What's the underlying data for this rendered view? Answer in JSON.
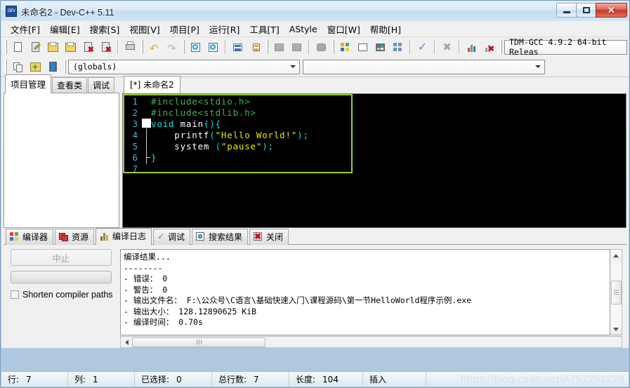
{
  "window": {
    "title": "未命名2 - Dev-C++ 5.11",
    "app_icon": "devcpp-icon",
    "minimize_label": "最小化",
    "maximize_label": "还原",
    "close_label": "关闭"
  },
  "menubar": [
    {
      "text": "文件[F]",
      "name": "menu-file"
    },
    {
      "text": "编辑[E]",
      "name": "menu-edit"
    },
    {
      "text": "搜索[S]",
      "name": "menu-search"
    },
    {
      "text": "视图[V]",
      "name": "menu-view"
    },
    {
      "text": "项目[P]",
      "name": "menu-project"
    },
    {
      "text": "运行[R]",
      "name": "menu-run"
    },
    {
      "text": "工具[T]",
      "name": "menu-tools"
    },
    {
      "text": "AStyle",
      "name": "menu-astyle"
    },
    {
      "text": "窗口[W]",
      "name": "menu-window"
    },
    {
      "text": "帮助[H]",
      "name": "menu-help"
    }
  ],
  "toolbar": {
    "icons": [
      "new-file-icon",
      "open-file-icon",
      "save-icon",
      "save-all-icon",
      "close-file-icon",
      "close-all-icon",
      "print-icon",
      "undo-icon",
      "redo-icon",
      "find-icon",
      "replace-icon",
      "goto-line-icon",
      "goto-function-icon",
      "back-icon",
      "forward-icon",
      "toggle-panel-icon",
      "compile-icon",
      "run-icon",
      "compile-run-icon",
      "rebuild-all-icon",
      "syntax-check-icon",
      "stop-execution-icon",
      "profile-icon",
      "debug-icon"
    ],
    "compiler_set": "TDM-GCC 4.9.2 64-bit Releas"
  },
  "toolbar2": {
    "icons": [
      "insert-icon",
      "toggle-bookmark-icon",
      "goto-bookmark-icon"
    ],
    "scope_combo": "(globals)",
    "member_combo": ""
  },
  "left_panel": {
    "tabs": [
      {
        "label": "项目管理",
        "name": "tab-project-manager",
        "active": true
      },
      {
        "label": "查看类",
        "name": "tab-class-browser",
        "active": false
      },
      {
        "label": "调试",
        "name": "tab-debug",
        "active": false
      }
    ]
  },
  "editor": {
    "tab_label": "[*] 未命名2",
    "lines": [
      {
        "num": "1",
        "tokens": [
          {
            "t": "#include<stdio.h>",
            "c": "c-pre"
          }
        ]
      },
      {
        "num": "2",
        "tokens": [
          {
            "t": "#include<stdlib.h>",
            "c": "c-pre"
          }
        ]
      },
      {
        "num": "3",
        "tokens": [
          {
            "t": "void ",
            "c": "c-kw"
          },
          {
            "t": "main",
            "c": "c-id"
          },
          {
            "t": "(){",
            "c": "c-pun"
          }
        ]
      },
      {
        "num": "4",
        "tokens": [
          {
            "t": "    printf",
            "c": "c-id"
          },
          {
            "t": "(",
            "c": "c-pun"
          },
          {
            "t": "\"Hello World!\"",
            "c": "c-str"
          },
          {
            "t": ");",
            "c": "c-pun"
          }
        ]
      },
      {
        "num": "5",
        "tokens": [
          {
            "t": "    system ",
            "c": "c-id"
          },
          {
            "t": "(",
            "c": "c-pun"
          },
          {
            "t": "\"pause\"",
            "c": "c-str"
          },
          {
            "t": ");",
            "c": "c-pun"
          }
        ]
      },
      {
        "num": "6",
        "tokens": [
          {
            "t": "}",
            "c": "c-pun"
          }
        ]
      },
      {
        "num": "7",
        "tokens": [
          {
            "t": "",
            "c": "c-id"
          }
        ]
      }
    ],
    "colors": {
      "background": "#000000",
      "preprocessor": "#3cb44a",
      "keyword": "#00e5e5",
      "identifier": "#ffffff",
      "string": "#e6e600",
      "line_number": "#3cb4e6",
      "highlight_border": "#9acd32"
    }
  },
  "bottom_panel": {
    "tabs": [
      {
        "label": "编译器",
        "name": "tab-compiler",
        "icon": "compiler-icon",
        "active": false
      },
      {
        "label": "资源",
        "name": "tab-resources",
        "icon": "resources-icon",
        "active": false
      },
      {
        "label": "编译日志",
        "name": "tab-compile-log",
        "icon": "log-icon",
        "active": true
      },
      {
        "label": "调试",
        "name": "tab-debug-bottom",
        "icon": "check-icon",
        "active": false
      },
      {
        "label": "搜索结果",
        "name": "tab-search-results",
        "icon": "search-icon",
        "active": false
      },
      {
        "label": "关闭",
        "name": "tab-close",
        "icon": "close-icon",
        "active": false
      }
    ],
    "abort_button": "中止",
    "progress_value": "",
    "shorten_paths_label": "Shorten compiler paths",
    "shorten_paths_checked": false,
    "log_text": "编译结果...\n--------\n- 错误： 0\n- 警告： 0\n- 输出文件名： F:\\公众号\\C语言\\基础快速入门\\课程源码\\第一节HelloWorld程序示例.exe\n- 输出大小： 128.12890625 KiB\n- 编译时间： 0.70s"
  },
  "statusbar": {
    "row_label": "行:",
    "row_value": "7",
    "col_label": "列:",
    "col_value": "1",
    "sel_label": "已选择:",
    "sel_value": "0",
    "total_label": "总行数:",
    "total_value": "7",
    "len_label": "长度:",
    "len_value": "104",
    "mode": "插入",
    "watermark": "https://blog.csdn.net/A757291228"
  }
}
